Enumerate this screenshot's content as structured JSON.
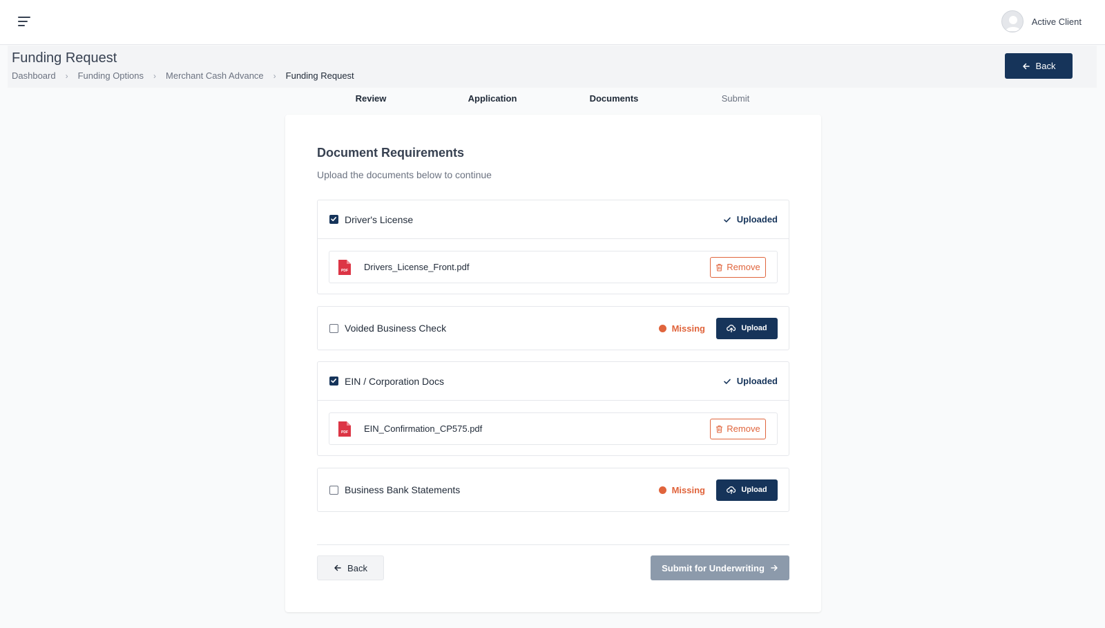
{
  "topbar": {
    "menu_icon": "hamburger-menu-icon",
    "profile": {
      "name": "Active Client",
      "avatar_icon": "user-avatar-icon"
    }
  },
  "header": {
    "title": "Funding Request",
    "breadcrumb": [
      "Dashboard",
      "Funding Options",
      "Merchant Cash Advance",
      "Funding Request"
    ],
    "back_label": "Back"
  },
  "steps": [
    {
      "label": "Review",
      "state": "done"
    },
    {
      "label": "Application",
      "state": "done"
    },
    {
      "label": "Documents",
      "state": "current"
    },
    {
      "label": "Submit",
      "state": "pending"
    }
  ],
  "card": {
    "title": "Document Requirements",
    "subtitle": "Upload the documents below to continue"
  },
  "documents": [
    {
      "label": "Driver's License",
      "checked": true,
      "status": "Uploaded",
      "file": "Drivers_License_Front.pdf",
      "remove_label": "Remove"
    },
    {
      "label": "Voided Business Check",
      "checked": false,
      "status": "Missing",
      "upload_label": "Upload"
    },
    {
      "label": "EIN / Corporation Docs",
      "checked": true,
      "status": "Uploaded",
      "file": "EIN_Confirmation_CP575.pdf",
      "remove_label": "Remove"
    },
    {
      "label": "Business Bank Statements",
      "checked": false,
      "status": "Missing",
      "upload_label": "Upload"
    }
  ],
  "footer": {
    "back_label": "Back",
    "submit_label": "Submit for Underwriting"
  },
  "colors": {
    "primary": "#16345a",
    "missing": "#e0643c",
    "pdf": "#dc3545",
    "submit_disabled": "#8c9aab"
  }
}
